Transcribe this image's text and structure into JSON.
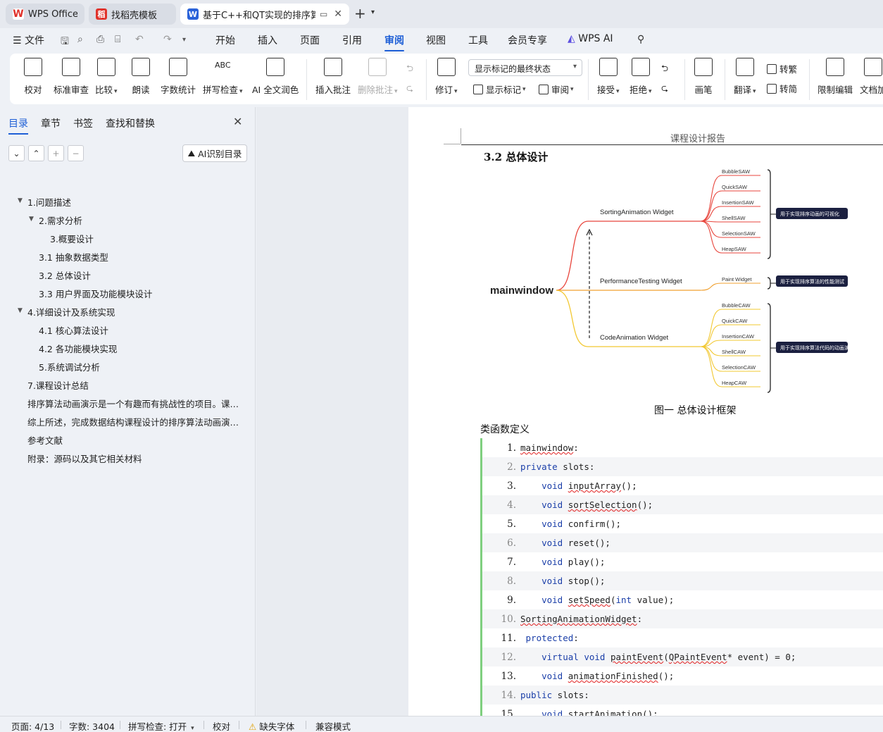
{
  "tabs": [
    {
      "label": "WPS Office",
      "logo": "W",
      "logo_color": "#e0322b"
    },
    {
      "label": "找稻壳模板",
      "logo": "稻",
      "logo_color": "#e0322b"
    },
    {
      "label": "基于C++和QT实现的排序算法",
      "logo": "W",
      "logo_color": "#2a62d9"
    }
  ],
  "menu": {
    "file": "文件",
    "items": [
      "开始",
      "插入",
      "页面",
      "引用",
      "审阅",
      "视图",
      "工具",
      "会员专享"
    ],
    "active": "审阅",
    "wps_ai": "WPS AI"
  },
  "ribbon": {
    "proofread": "校对",
    "standard_review": "标准审查",
    "compare": "比较",
    "read_aloud": "朗读",
    "word_count": "字数统计",
    "spell_check": "拼写检查",
    "ai_polish": "AI 全文润色",
    "insert_comment": "插入批注",
    "delete_comment": "删除批注",
    "track_changes": "修订",
    "markup_mode": "显示标记的最终状态",
    "show_markup": "显示标记",
    "review": "审阅",
    "accept": "接受",
    "reject": "拒绝",
    "pen": "画笔",
    "translate": "翻译",
    "to_traditional": "转繁",
    "to_simplified": "转简",
    "restrict_edit": "限制编辑",
    "doc_encrypt": "文档加"
  },
  "nav": {
    "tabs": [
      "目录",
      "章节",
      "书签",
      "查找和替换"
    ],
    "ai_toc": "AI识别目录",
    "toc": [
      {
        "text": "1.问题描述",
        "level": 0,
        "arrow": true
      },
      {
        "text": "2.需求分析",
        "level": 1,
        "arrow": true
      },
      {
        "text": "3.概要设计",
        "level": 2,
        "arrow": false
      },
      {
        "text": "3.1 抽象数据类型",
        "level": 1,
        "arrow": false
      },
      {
        "text": "3.2  总体设计",
        "level": 1,
        "arrow": false
      },
      {
        "text": "3.3  用户界面及功能模块设计",
        "level": 1,
        "arrow": false
      },
      {
        "text": "4.详细设计及系统实现",
        "level": 0,
        "arrow": true
      },
      {
        "text": "4.1  核心算法设计",
        "level": 1,
        "arrow": false
      },
      {
        "text": "4.2  各功能模块实现",
        "level": 1,
        "arrow": false
      },
      {
        "text": "5.系统调试分析",
        "level": 1,
        "arrow": false
      },
      {
        "text": "7.课程设计总结",
        "level": 0,
        "arrow": false
      },
      {
        "text": "排序算法动画演示是一个有趣而有挑战性的项目。课程设计",
        "level": 0,
        "arrow": false
      },
      {
        "text": "综上所述，完成数据结构课程设计的排序算法动画演示项目",
        "level": 0,
        "arrow": false
      },
      {
        "text": "参考文献",
        "level": 0,
        "arrow": false
      },
      {
        "text": "附录：源码以及其它相关材料",
        "level": 0,
        "arrow": false
      }
    ]
  },
  "doc": {
    "header": "课程设计报告",
    "section_title": "3.2  总体设计",
    "figure_caption": "图一  总体设计框架",
    "class_def_title": "类函数定义",
    "diagram": {
      "root": "mainwindow",
      "branches": [
        {
          "name": "SortingAnimation Widget",
          "color": "#e8453c",
          "leaves": [
            "BubbleSAW",
            "QuickSAW",
            "InsertionSAW",
            "ShellSAW",
            "SelectionSAW",
            "HeapSAW"
          ],
          "note": "用于实现排序动画的可视化"
        },
        {
          "name": "PerformanceTesting Widget",
          "color": "#f0a030",
          "leaves": [
            "Paint Widget"
          ],
          "note": "用于实现排序算法的性能测试"
        },
        {
          "name": "CodeAnimation Widget",
          "color": "#f2c832",
          "leaves": [
            "BubbleCAW",
            "QuickCAW",
            "InsertionCAW",
            "ShellCAW",
            "SelectionCAW",
            "HeapCAW"
          ],
          "note": "用于实现排序算法代码的动画演示"
        }
      ]
    },
    "code_lines": [
      {
        "n": "1.",
        "html": "<span class=\"sq\">mainwindow</span>:"
      },
      {
        "n": "2.",
        "html": "<span class=\"kw\">private</span> slots:"
      },
      {
        "n": "3.",
        "html": "    <span class=\"kw\">void</span> <span class=\"sq\">inputArray</span>();"
      },
      {
        "n": "4.",
        "html": "    <span class=\"kw\">void</span> <span class=\"sq\">sortSelection</span>();"
      },
      {
        "n": "5.",
        "html": "    <span class=\"kw\">void</span> confirm();"
      },
      {
        "n": "6.",
        "html": "    <span class=\"kw\">void</span> reset();"
      },
      {
        "n": "7.",
        "html": "    <span class=\"kw\">void</span> play();"
      },
      {
        "n": "8.",
        "html": "    <span class=\"kw\">void</span> stop();"
      },
      {
        "n": "9.",
        "html": "    <span class=\"kw\">void</span> <span class=\"sq\">setSpeed</span>(<span class=\"kw\">int</span> value);"
      },
      {
        "n": "10.",
        "html": "<span class=\"sq\">SortingAnimationWidget</span>:"
      },
      {
        "n": "11.",
        "html": " <span class=\"kw\">protected</span>:"
      },
      {
        "n": "12.",
        "html": "    <span class=\"kw\">virtual</span> <span class=\"kw\">void</span> <span class=\"sq\">paintEvent</span>(<span class=\"sq\">QPaintEvent</span>* event) = 0;"
      },
      {
        "n": "13.",
        "html": "    <span class=\"kw\">void</span> <span class=\"sq\">animationFinished</span>();"
      },
      {
        "n": "14.",
        "html": "<span class=\"kw\">public</span> slots:"
      },
      {
        "n": "15.",
        "html": "    <span class=\"kw\">void</span> <span class=\"sq\">startAnimation</span>();"
      }
    ]
  },
  "status": {
    "page": "页面: 4/13",
    "words": "字数: 3404",
    "spell": "拼写检查: 打开",
    "proof": "校对",
    "missing_font": "缺失字体",
    "compat": "兼容模式"
  }
}
